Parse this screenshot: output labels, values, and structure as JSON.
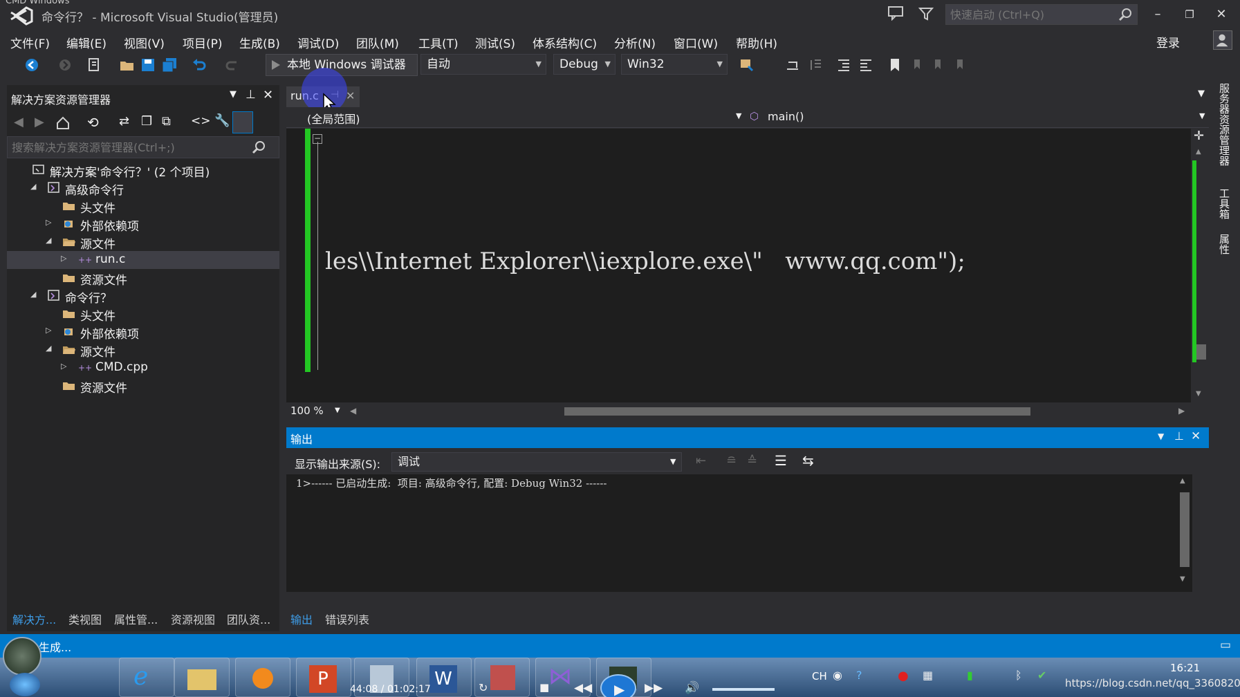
{
  "window": {
    "overlay_title": "CMD Windows",
    "title": "命令行？ - Microsoft Visual Studio(管理员)",
    "quick_launch_placeholder": "快速启动 (Ctrl+Q)",
    "login": "登录"
  },
  "menu": [
    "文件(F)",
    "编辑(E)",
    "视图(V)",
    "项目(P)",
    "生成(B)",
    "调试(D)",
    "团队(M)",
    "工具(T)",
    "测试(S)",
    "体系结构(C)",
    "分析(N)",
    "窗口(W)",
    "帮助(H)"
  ],
  "toolbar": {
    "debugger_label": "本地 Windows 调试器",
    "solution_config_auto": "自动",
    "configuration": "Debug",
    "platform": "Win32"
  },
  "solution_explorer": {
    "title": "解决方案资源管理器",
    "search_placeholder": "搜索解决方案资源管理器(Ctrl+;)",
    "tree": [
      {
        "label": "解决方案'命令行？' (2 个项目)",
        "level": 0,
        "expander": "",
        "icon": "solution-icon"
      },
      {
        "label": "高级命令行",
        "level": 1,
        "expander": "◢",
        "icon": "project-icon"
      },
      {
        "label": "头文件",
        "level": 2,
        "expander": "",
        "icon": "folder-icon"
      },
      {
        "label": "外部依赖项",
        "level": 2,
        "expander": "▷",
        "icon": "dependency-icon"
      },
      {
        "label": "源文件",
        "level": 2,
        "expander": "◢",
        "icon": "folder-open-icon"
      },
      {
        "label": "run.c",
        "level": 3,
        "expander": "▷",
        "icon": "source-file-icon",
        "selected": true
      },
      {
        "label": "资源文件",
        "level": 2,
        "expander": "",
        "icon": "folder-icon"
      },
      {
        "label": "命令行？",
        "level": 1,
        "expander": "◢",
        "icon": "project-icon"
      },
      {
        "label": "头文件",
        "level": 2,
        "expander": "",
        "icon": "folder-icon"
      },
      {
        "label": "外部依赖项",
        "level": 2,
        "expander": "▷",
        "icon": "dependency-icon"
      },
      {
        "label": "源文件",
        "level": 2,
        "expander": "◢",
        "icon": "folder-open-icon"
      },
      {
        "label": "CMD.cpp",
        "level": 3,
        "expander": "▷",
        "icon": "source-file-icon"
      },
      {
        "label": "资源文件",
        "level": 2,
        "expander": "",
        "icon": "folder-icon"
      }
    ],
    "bottom_tabs": [
      "解决方...",
      "类视图",
      "属性管...",
      "资源视图",
      "团队资..."
    ]
  },
  "editor": {
    "tab_label": "run.c",
    "scope": "(全局范围)",
    "function": "main()",
    "code_line": "les\\\\Internet Explorer\\\\iexplore.exe\\\"   www.qq.com\");",
    "zoom": "100 %"
  },
  "output": {
    "title": "输出",
    "source_label": "显示输出来源(S):",
    "source_value": "调试",
    "text": "1>------ 已启动生成:  项目: 高级命令行, 配置: Debug Win32 ------",
    "tabs": [
      "输出",
      "错误列表"
    ]
  },
  "right_tabs": [
    "服务器资源管理器",
    "工具箱",
    "属性"
  ],
  "status": {
    "text": "生成..."
  },
  "taskbar": {
    "media_time": "44:08 / 01:02:17",
    "lang": "CH",
    "clock": "16:21",
    "watermark": "https://blog.csdn.net/qq_33608200"
  },
  "colors": {
    "accent": "#007acc",
    "background": "#2d2d30",
    "editor": "#1e1e1e",
    "change_bar": "#23c723"
  }
}
